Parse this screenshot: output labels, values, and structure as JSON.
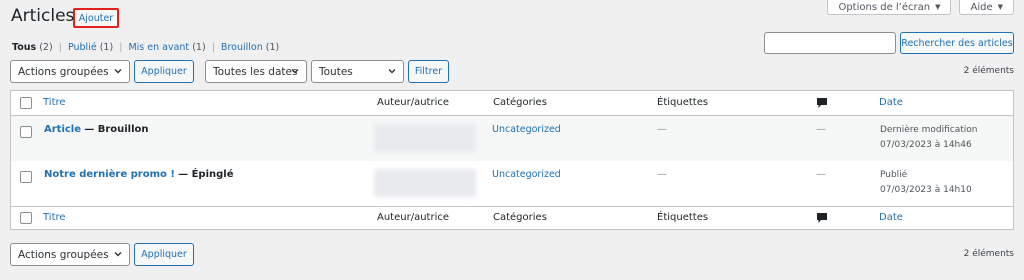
{
  "screen_options": {
    "options_label": "Options de l’écran",
    "help_label": "Aide"
  },
  "header": {
    "title": "Articles",
    "add_label": "Ajouter"
  },
  "filters_links": [
    {
      "label": "Tous",
      "count": "(2)"
    },
    {
      "label": "Publié",
      "count": "(1)"
    },
    {
      "label": "Mis en avant",
      "count": "(1)"
    },
    {
      "label": "Brouillon",
      "count": "(1)"
    }
  ],
  "search": {
    "value": "",
    "button_label": "Rechercher des articles"
  },
  "toolbar_top": {
    "bulk_actions": "Actions groupées",
    "apply": "Appliquer",
    "dates": "Toutes les dates",
    "categories": "Toutes",
    "filter": "Filtrer",
    "items_count": "2 éléments"
  },
  "table": {
    "columns": {
      "title": "Titre",
      "author": "Auteur/autrice",
      "categories": "Catégories",
      "tags": "Étiquettes",
      "date": "Date"
    },
    "rows": [
      {
        "title": "Article",
        "state": "— Brouillon",
        "category": "Uncategorized",
        "tags": "—",
        "comments": "—",
        "date_status": "Dernière modification",
        "date_value": "07/03/2023 à 14h46"
      },
      {
        "title": "Notre dernière promo !",
        "state": "— Épinglé",
        "category": "Uncategorized",
        "tags": "—",
        "comments": "—",
        "date_status": "Publié",
        "date_value": "07/03/2023 à 14h10"
      }
    ]
  },
  "toolbar_bottom": {
    "bulk_actions": "Actions groupées",
    "apply": "Appliquer",
    "items_count": "2 éléments"
  },
  "colors": {
    "link": "#2271b1",
    "highlight_border": "#e2211c",
    "background": "#f0f0f1"
  }
}
